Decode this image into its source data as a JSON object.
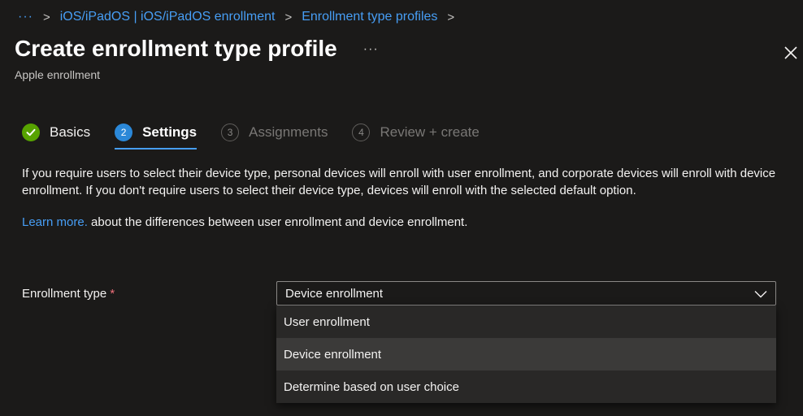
{
  "breadcrumb": {
    "ellipsis": "···",
    "separator": ">",
    "items": [
      "iOS/iPadOS | iOS/iPadOS enrollment",
      "Enrollment type profiles"
    ]
  },
  "header": {
    "title": "Create enrollment type profile",
    "more": "···",
    "subtitle": "Apple enrollment"
  },
  "steps": [
    {
      "num": "✓",
      "label": "Basics",
      "state": "done"
    },
    {
      "num": "2",
      "label": "Settings",
      "state": "active"
    },
    {
      "num": "3",
      "label": "Assignments",
      "state": "todo"
    },
    {
      "num": "4",
      "label": "Review + create",
      "state": "todo"
    }
  ],
  "content": {
    "description": "If you require users to select their device type, personal devices will enroll with user enrollment, and corporate devices will enroll with device enrollment. If you don't require users to select their device type, devices will enroll with the selected default option.",
    "learn_link": "Learn more.",
    "learn_rest": " about the differences between user enrollment and device enrollment."
  },
  "form": {
    "enrollment_type_label": "Enrollment type",
    "required_mark": "*",
    "selected_value": "Device enrollment",
    "options": [
      "User enrollment",
      "Device enrollment",
      "Determine based on user choice"
    ]
  },
  "colors": {
    "background": "#1b1a19",
    "accent": "#479ef5",
    "success": "#57a300",
    "required": "#f1707b"
  }
}
